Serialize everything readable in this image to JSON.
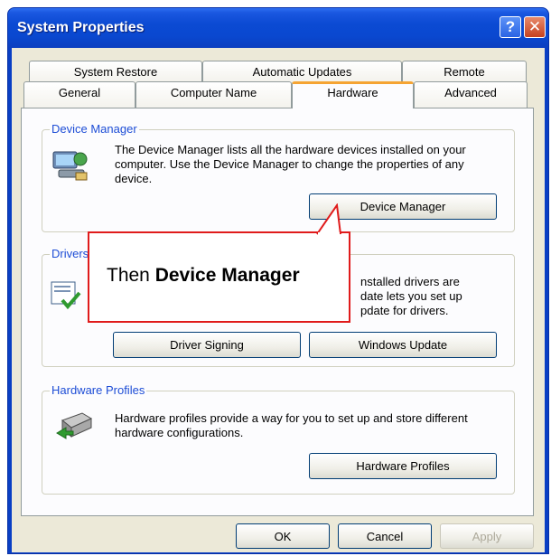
{
  "window": {
    "title": "System Properties",
    "help_glyph": "?",
    "close_glyph": "✕"
  },
  "tabs_top": [
    "System Restore",
    "Automatic Updates",
    "Remote"
  ],
  "tabs_bottom": [
    "General",
    "Computer Name",
    "Hardware",
    "Advanced"
  ],
  "active_tab": "Hardware",
  "device_manager": {
    "group_label": "Device Manager",
    "description": "The Device Manager lists all the hardware devices installed on your computer. Use the Device Manager to change the properties of any device.",
    "button": "Device Manager"
  },
  "drivers": {
    "group_label": "Drivers",
    "description_visible": "nstalled drivers are\ndate lets you set up\npdate for drivers.",
    "buttons": [
      "Driver Signing",
      "Windows Update"
    ]
  },
  "hardware_profiles": {
    "group_label": "Hardware Profiles",
    "description": "Hardware profiles provide a way for you to set up and store different hardware configurations.",
    "button": "Hardware Profiles"
  },
  "footer": {
    "ok": "OK",
    "cancel": "Cancel",
    "apply": "Apply"
  },
  "callout": {
    "prefix": "Then ",
    "emphasis": "Device Manager"
  },
  "colors": {
    "titlebar": "#0a48d0",
    "accent_tab": "#f5a433",
    "callout_border": "#e01b1b",
    "group_label": "#1d4dd6"
  }
}
